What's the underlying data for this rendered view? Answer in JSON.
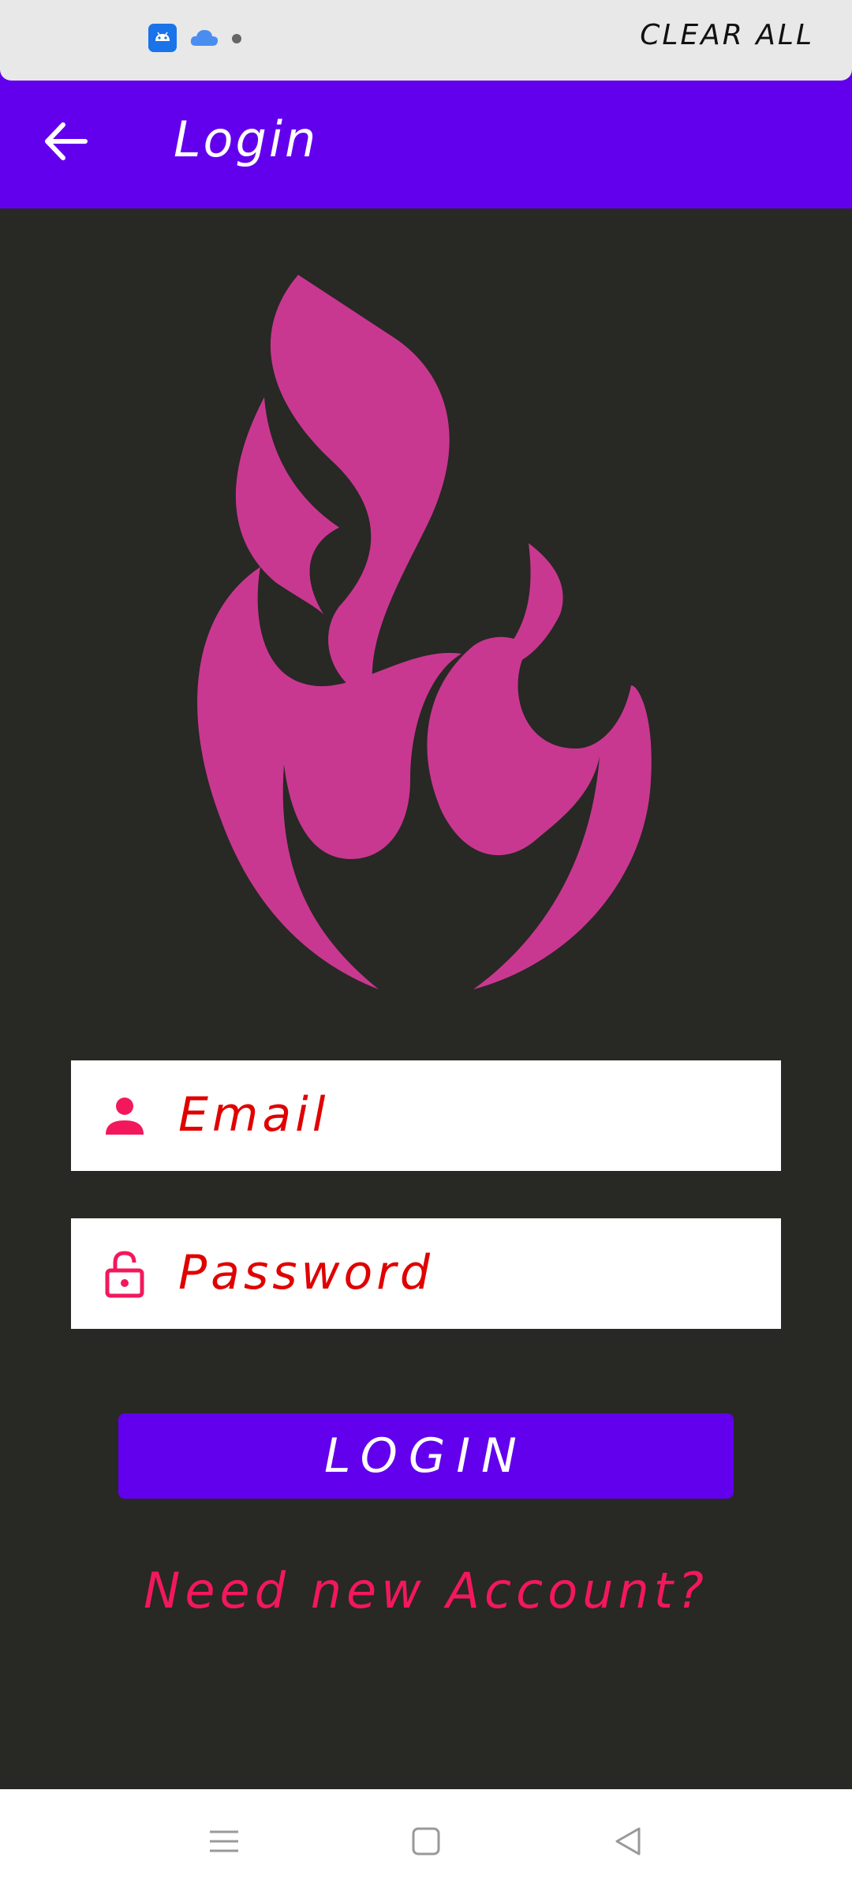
{
  "notification_shade": {
    "clear_all_label": "CLEAR ALL",
    "icons": [
      "android-icon",
      "cloud-icon",
      "dot-icon"
    ]
  },
  "appbar": {
    "title": "Login",
    "back_icon": "arrow-left-icon"
  },
  "logo": {
    "icon": "flame-icon",
    "color": "#c93890"
  },
  "form": {
    "email_placeholder": "Email",
    "password_placeholder": "Password",
    "email_icon": "person-icon",
    "password_icon": "lock-icon",
    "login_label": "LOGIN",
    "new_account_link": "Need new Account?"
  },
  "colors": {
    "primary": "#6200ee",
    "background": "#282825",
    "input_text": "#e00000",
    "icon_accent": "#f2185b",
    "link": "#f2185b"
  },
  "navbar": {
    "icons": [
      "menu-icon",
      "home-icon",
      "back-icon"
    ]
  }
}
